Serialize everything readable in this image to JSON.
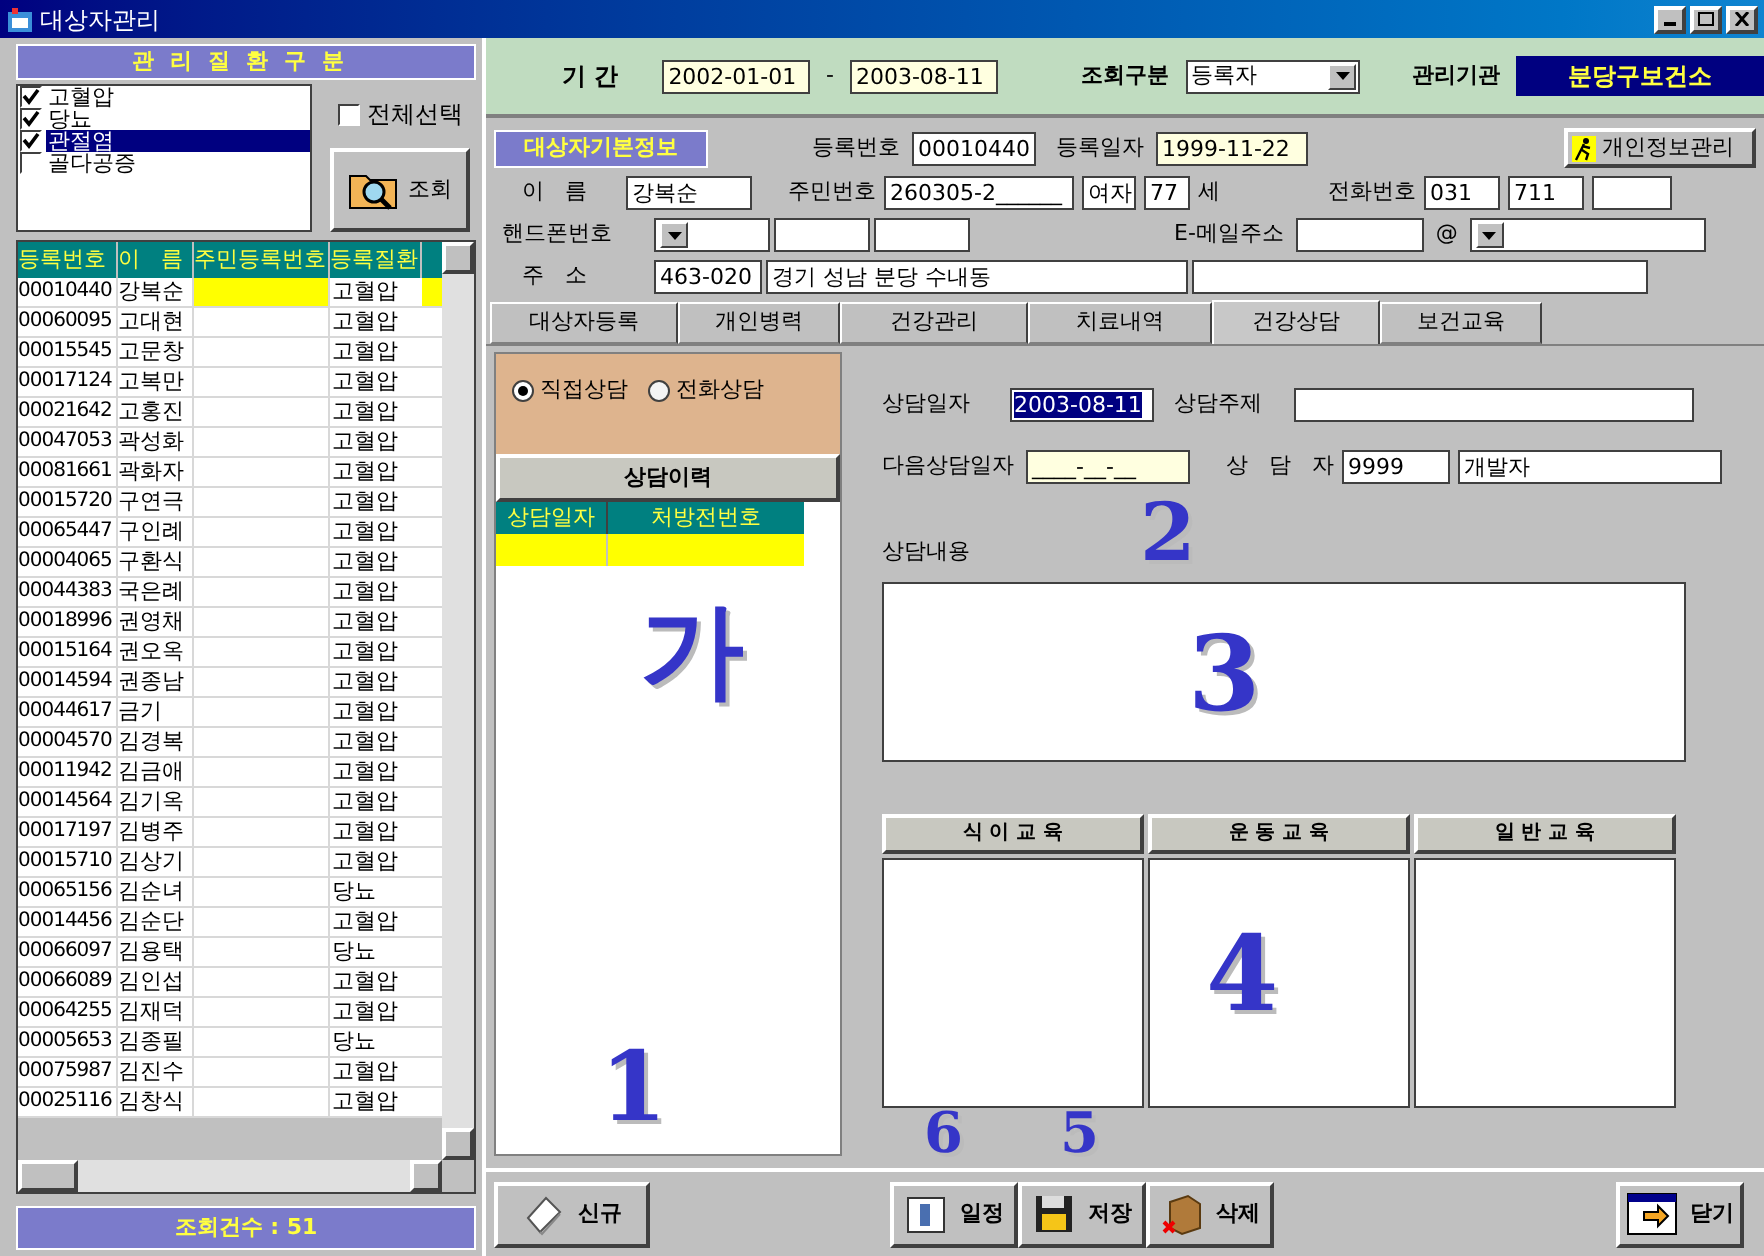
{
  "window": {
    "title": "대상자관리"
  },
  "disease_filter": {
    "title": "관리질환구분",
    "items": [
      {
        "label": "고혈압",
        "checked": true,
        "selected": false
      },
      {
        "label": "당뇨",
        "checked": true,
        "selected": false
      },
      {
        "label": "관절염",
        "checked": true,
        "selected": true
      },
      {
        "label": "골다공증",
        "checked": false,
        "selected": false
      }
    ],
    "select_all": {
      "label": "전체선택",
      "checked": false
    },
    "search_button": "조회"
  },
  "patient_table": {
    "columns": [
      "등록번호",
      "이   름",
      "주민등록번호",
      "등록질환"
    ],
    "rows": [
      {
        "id": "00010440",
        "name": "강복순",
        "disease": "고혈압",
        "selected": true
      },
      {
        "id": "00060095",
        "name": "고대현",
        "disease": "고혈압",
        "selected": false
      },
      {
        "id": "00015545",
        "name": "고문창",
        "disease": "고혈압",
        "selected": false
      },
      {
        "id": "00017124",
        "name": "고복만",
        "disease": "고혈압",
        "selected": false
      },
      {
        "id": "00021642",
        "name": "고홍진",
        "disease": "고혈압",
        "selected": false
      },
      {
        "id": "00047053",
        "name": "곽성화",
        "disease": "고혈압",
        "selected": false
      },
      {
        "id": "00081661",
        "name": "곽화자",
        "disease": "고혈압",
        "selected": false
      },
      {
        "id": "00015720",
        "name": "구연극",
        "disease": "고혈압",
        "selected": false
      },
      {
        "id": "00065447",
        "name": "구인례",
        "disease": "고혈압",
        "selected": false
      },
      {
        "id": "00004065",
        "name": "구환식",
        "disease": "고혈압",
        "selected": false
      },
      {
        "id": "00044383",
        "name": "국은례",
        "disease": "고혈압",
        "selected": false
      },
      {
        "id": "00018996",
        "name": "권영채",
        "disease": "고혈압",
        "selected": false
      },
      {
        "id": "00015164",
        "name": "권오옥",
        "disease": "고혈압",
        "selected": false
      },
      {
        "id": "00014594",
        "name": "권종남",
        "disease": "고혈압",
        "selected": false
      },
      {
        "id": "00044617",
        "name": "금기",
        "disease": "고혈압",
        "selected": false
      },
      {
        "id": "00004570",
        "name": "김경복",
        "disease": "고혈압",
        "selected": false
      },
      {
        "id": "00011942",
        "name": "김금애",
        "disease": "고혈압",
        "selected": false
      },
      {
        "id": "00014564",
        "name": "김기옥",
        "disease": "고혈압",
        "selected": false
      },
      {
        "id": "00017197",
        "name": "김병주",
        "disease": "고혈압",
        "selected": false
      },
      {
        "id": "00015710",
        "name": "김상기",
        "disease": "고혈압",
        "selected": false
      },
      {
        "id": "00065156",
        "name": "김순녀",
        "disease": "당뇨",
        "selected": false
      },
      {
        "id": "00014456",
        "name": "김순단",
        "disease": "고혈압",
        "selected": false
      },
      {
        "id": "00066097",
        "name": "김용택",
        "disease": "당뇨",
        "selected": false
      },
      {
        "id": "00066089",
        "name": "김인섭",
        "disease": "고혈압",
        "selected": false
      },
      {
        "id": "00064255",
        "name": "김재덕",
        "disease": "고혈압",
        "selected": false
      },
      {
        "id": "00005653",
        "name": "김종필",
        "disease": "당뇨",
        "selected": false
      },
      {
        "id": "00075987",
        "name": "김진수",
        "disease": "고혈압",
        "selected": false
      },
      {
        "id": "00025116",
        "name": "김창식",
        "disease": "고혈압",
        "selected": false
      }
    ]
  },
  "count_bar": "조회건수 : 51",
  "filter": {
    "period_label": "기 간",
    "from": "2002-01-01",
    "dash": "-",
    "to": "2003-08-11",
    "mode_label": "조회구분",
    "mode": "등록자",
    "agency_label": "관리기관",
    "agency": "분당구보건소"
  },
  "basic_info": {
    "title": "대상자기본정보",
    "reg_no_label": "등록번호",
    "reg_no": "00010440",
    "reg_date_label": "등록일자",
    "reg_date": "1999-11-22",
    "privacy_button": "개인정보관리",
    "name_label": "이   름",
    "name": "강복순",
    "rrn_label": "주민번호",
    "rrn": "260305-2______",
    "sex": "여자",
    "age": "77",
    "age_unit": "세",
    "phone_label": "전화번호",
    "phone": [
      "031",
      "711"
    ],
    "mobile_label": "핸드폰번호",
    "email_label": "E-메일주소",
    "at": "@",
    "address_label": "주   소",
    "zip": "463-020",
    "address": "경기 성남 분당 수내동"
  },
  "tabs": [
    {
      "label": "대상자등록",
      "selected": false
    },
    {
      "label": "개인병력",
      "selected": false
    },
    {
      "label": "건강관리",
      "selected": false
    },
    {
      "label": "치료내역",
      "selected": false
    },
    {
      "label": "건강상담",
      "selected": true
    },
    {
      "label": "보건교육",
      "selected": false
    }
  ],
  "consult": {
    "types": [
      {
        "label": "직접상담",
        "selected": true
      },
      {
        "label": "전화상담",
        "selected": false
      }
    ],
    "history_title": "상담이력",
    "history_columns": [
      "상담일자",
      "처방전번호"
    ],
    "date_label": "상담일자",
    "date": "2003-08-11",
    "topic_label": "상담주제",
    "next_label": "다음상담일자",
    "next_date": "____-__-__",
    "counselor_label": "상   담   자",
    "counselor_id": "9999",
    "counselor_name": "개발자",
    "content_label": "상담내용",
    "education": [
      "식 이 교 육",
      "운 동 교 육",
      "일 반 교 육"
    ]
  },
  "buttons": [
    {
      "label": "신규",
      "kind": "new"
    },
    {
      "label": "일정",
      "kind": "schedule"
    },
    {
      "label": "저장",
      "kind": "save"
    },
    {
      "label": "삭제",
      "kind": "delete"
    },
    {
      "label": "닫기",
      "kind": "close"
    }
  ],
  "annotations": [
    "가",
    "2",
    "3",
    "4",
    "1",
    "6",
    "5"
  ]
}
